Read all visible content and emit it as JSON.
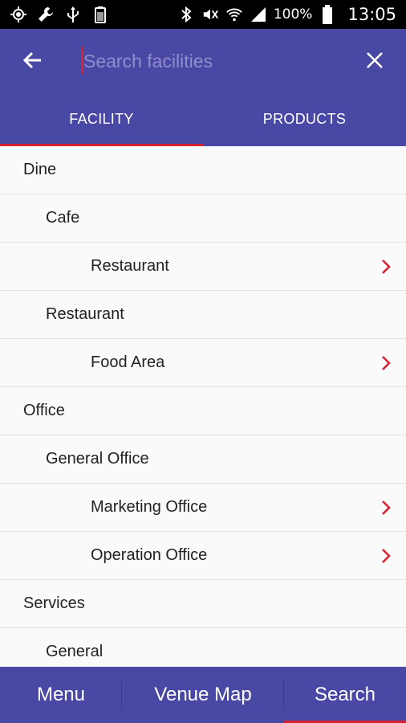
{
  "status_bar": {
    "battery_percent": "100%",
    "time": "13:05",
    "icons": [
      "gps-icon",
      "wrench-icon",
      "usb-icon",
      "battery-saver-icon",
      "bluetooth-icon",
      "mute-icon",
      "wifi-icon",
      "signal-icon",
      "battery-icon"
    ]
  },
  "app_bar": {
    "back_icon": "arrow-left-icon",
    "search_placeholder": "Search facilities",
    "search_value": "",
    "close_icon": "close-icon",
    "background_color": "#4a48a5",
    "accent_color": "#d8232f"
  },
  "tabs": [
    {
      "label": "FACILITY",
      "active": true
    },
    {
      "label": "PRODUCTS",
      "active": false
    }
  ],
  "list": [
    {
      "label": "Dine",
      "level": 0,
      "has_chevron": false
    },
    {
      "label": "Cafe",
      "level": 1,
      "has_chevron": false
    },
    {
      "label": "Restaurant",
      "level": 2,
      "has_chevron": true
    },
    {
      "label": "Restaurant",
      "level": 1,
      "has_chevron": false
    },
    {
      "label": "Food Area",
      "level": 2,
      "has_chevron": true
    },
    {
      "label": "Office",
      "level": 0,
      "has_chevron": false
    },
    {
      "label": "General Office",
      "level": 1,
      "has_chevron": false
    },
    {
      "label": "Marketing Office",
      "level": 2,
      "has_chevron": true
    },
    {
      "label": "Operation Office",
      "level": 2,
      "has_chevron": true
    },
    {
      "label": "Services",
      "level": 0,
      "has_chevron": false
    },
    {
      "label": "General",
      "level": 1,
      "has_chevron": false
    }
  ],
  "bottom_nav": [
    {
      "label": "Menu",
      "active": false
    },
    {
      "label": "Venue Map",
      "active": false
    },
    {
      "label": "Search",
      "active": true
    }
  ]
}
